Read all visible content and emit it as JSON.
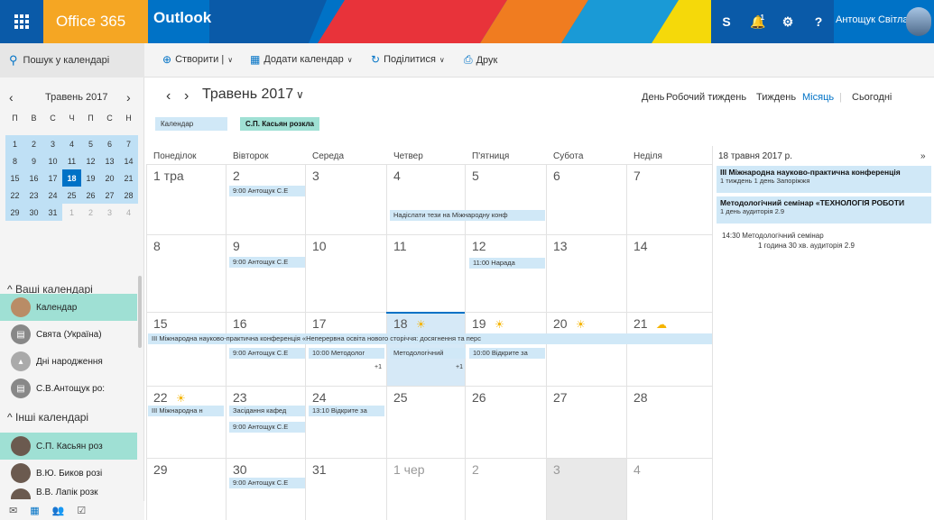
{
  "topbar": {
    "brand": "Office 365",
    "app": "Outlook",
    "skype": "S",
    "notif_badge": "1",
    "gear": "⚙",
    "help": "?",
    "user": "Антощук Світлана"
  },
  "commands": {
    "search": "Пошук у календарі",
    "create": "Створити |",
    "add_calendar": "Додати календар",
    "share": "Поділитися",
    "print": "Друк"
  },
  "mini_calendar": {
    "title": "Травень 2017",
    "weekdays": [
      "П",
      "В",
      "С",
      "Ч",
      "П",
      "С",
      "Н"
    ],
    "days": [
      {
        "d": "1"
      },
      {
        "d": "2"
      },
      {
        "d": "3"
      },
      {
        "d": "4"
      },
      {
        "d": "5"
      },
      {
        "d": "6"
      },
      {
        "d": "7"
      },
      {
        "d": "8"
      },
      {
        "d": "9"
      },
      {
        "d": "10"
      },
      {
        "d": "11"
      },
      {
        "d": "12"
      },
      {
        "d": "13"
      },
      {
        "d": "14"
      },
      {
        "d": "15"
      },
      {
        "d": "16"
      },
      {
        "d": "17"
      },
      {
        "d": "18",
        "today": true
      },
      {
        "d": "19"
      },
      {
        "d": "20"
      },
      {
        "d": "21"
      },
      {
        "d": "22"
      },
      {
        "d": "23"
      },
      {
        "d": "24"
      },
      {
        "d": "25"
      },
      {
        "d": "26"
      },
      {
        "d": "27"
      },
      {
        "d": "28"
      },
      {
        "d": "29"
      },
      {
        "d": "30"
      },
      {
        "d": "31"
      },
      {
        "d": "1",
        "other": true
      },
      {
        "d": "2",
        "other": true
      },
      {
        "d": "3",
        "other": true
      },
      {
        "d": "4",
        "other": true
      }
    ]
  },
  "sidebar": {
    "my_header": "Ваші календарі",
    "my_calendars": [
      "Календар",
      "Свята (Україна)",
      "Дні народження",
      "С.В.Антощук ро:"
    ],
    "other_header": "Інші календарі",
    "other_calendars": [
      "С.П. Касьян роз",
      "В.Ю. Биков розі",
      "В.В. Лапік розк"
    ]
  },
  "main": {
    "month_title": "Травень 2017",
    "views": {
      "day": "День",
      "workweek": "Робочий тиждень",
      "week": "Тиждень",
      "month": "Місяць",
      "today": "Сьогодні"
    },
    "chip_calendar": "Календар",
    "chip_kasyan": "С.П. Касьян розкла",
    "weekdays": [
      "Понеділок",
      "Вівторок",
      "Середа",
      "Четвер",
      "П'ятниця",
      "Субота",
      "Неділя"
    ],
    "day_numbers": [
      [
        "1 тра",
        "2",
        "3",
        "4",
        "5",
        "6",
        "7"
      ],
      [
        "8",
        "9",
        "10",
        "11",
        "12",
        "13",
        "14"
      ],
      [
        "15",
        "16",
        "17",
        "18",
        "19",
        "20",
        "21"
      ],
      [
        "22",
        "23",
        "24",
        "25",
        "26",
        "27",
        "28"
      ],
      [
        "29",
        "30",
        "31",
        "1 чер",
        "2",
        "3",
        "4"
      ]
    ],
    "events": {
      "w1_tue": "9:00 Антощук С.Е",
      "w1_thu": "Надіслати тези на Міжнародну конф",
      "w2_tue": "9:00 Антощук С.Е",
      "w2_fri": "11:00 Нарада",
      "w3_banner": "ІІІ Міжнародна науково-практична конференція «Неперервна освіта нового сторіччя: досягнення та перс",
      "w3_tue": "9:00 Антощук С.Е",
      "w3_wed": "10:00 Методолог",
      "w3_thu": "Методологічний",
      "w3_fri": "10:00 Відкрите за",
      "w3_plus1": "+1",
      "w3_plus2": "+1",
      "w4_mon": "ІІІ Міжнародна н",
      "w4_tue1": "Засідання кафед",
      "w4_tue2": "9:00 Антощук С.Е",
      "w4_wed": "13:10 Відкрите за",
      "w5_tue": "9:00 Антощук С.Е"
    }
  },
  "agenda": {
    "date": "18 травня 2017 р.",
    "more": "»",
    "ev1_title": "ІІІ Міжнародна науково-практична конференція",
    "ev1_sub": "1 тиждень 1 день Запоріжжя",
    "ev2_title": "Методологічний семінар «ТЕХНОЛОГІЯ РОБОТИ",
    "ev2_sub": "1 день аудиторія 2.9",
    "ev3_time": "14:30   Методологічний семінар",
    "ev3_sub": "1 година 30 хв.   аудиторія 2.9"
  },
  "colors": {
    "accent": "#0072c6",
    "brand": "#f5a623",
    "selected_calendar": "#9fe0d4",
    "event": "#d0e8f7"
  }
}
